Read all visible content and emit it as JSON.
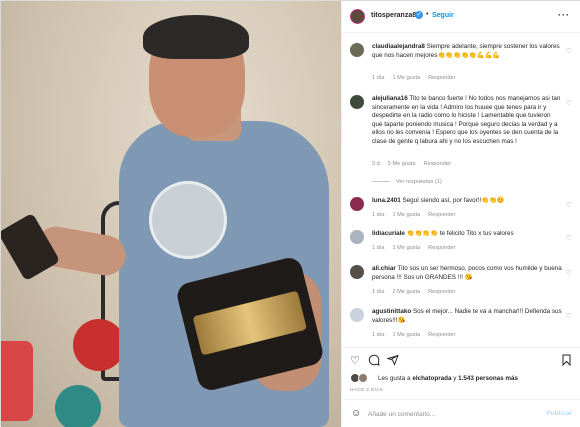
{
  "post": {
    "username": "titosperanza8",
    "verified_glyph": "✓",
    "follow_label": "Seguir",
    "more_glyph": "···"
  },
  "comments": [
    {
      "username": "claudiaalejandra8",
      "text": "Siempre adelante, siempre sostener los valores que nos hacen mejores👏👏👏👏👏💪💪💪",
      "time": "1 día",
      "likes": "1 Me gusta",
      "reply": "Responder",
      "avatar_color": "#6b6b56"
    },
    {
      "username": "alejuliana16",
      "text": "Tito te banco fuerte ! No todos nos manejamos asi tan sinceramente en la vida ! Admiro los huuee que tenes para ir y despedirte en la radio como lo hiciste ! Lamentable que tuvieron que taparte poniendo musica ! Porque seguro decias la verdad y a ellos no les convenia ! Espero que los oyentes se den cuenta de la clase de gente q labura ahi y no los escuchen mas !",
      "time": "5 d",
      "likes": "5 Me gusta",
      "reply": "Responder",
      "replies": "Ver respuestas (1)",
      "avatar_color": "#3e4a3a"
    },
    {
      "username": "luna.2401",
      "text": "Seguí siendo así, por favor!!👏👏😊",
      "time": "1 día",
      "likes": "1 Me gusta",
      "reply": "Responder",
      "avatar_color": "#8a2b4d"
    },
    {
      "username": "lidiacuriale",
      "text": "👏👏👏👏 te felicito Tito x tus valores",
      "time": "1 día",
      "likes": "1 Me gusta",
      "reply": "Responder",
      "avatar_color": "#a9b4bf"
    },
    {
      "username": "ali.chiar",
      "text": "Tito sos un ser hermoso, pocos como vos humilde y buena persona !!! Sos un GRANDES !!! 😘",
      "time": "1 día",
      "likes": "2 Me gusta",
      "reply": "Responder",
      "avatar_color": "#55504a"
    },
    {
      "username": "agustinittako",
      "text": "Sos el mejor... Nadie te va a manchar!!! Defienda sus valores!!!😘",
      "time": "1 día",
      "likes": "1 Me gusta",
      "reply": "Responder",
      "avatar_color": "#c9d2dc"
    }
  ],
  "actions": {
    "like_icon": "heart-outline",
    "comment_icon": "speech-bubble",
    "share_icon": "paper-plane",
    "save_icon": "bookmark"
  },
  "likes_summary": {
    "prefix": "Les gusta a ",
    "user": "elchatoprada",
    "middle": " y ",
    "count": "1.543 personas más"
  },
  "timestamp": "HACE 3 DÍAS",
  "add_comment": {
    "placeholder": "Añade un comentario...",
    "publish_label": "Publicar",
    "emoji_icon": "smiley-face"
  }
}
